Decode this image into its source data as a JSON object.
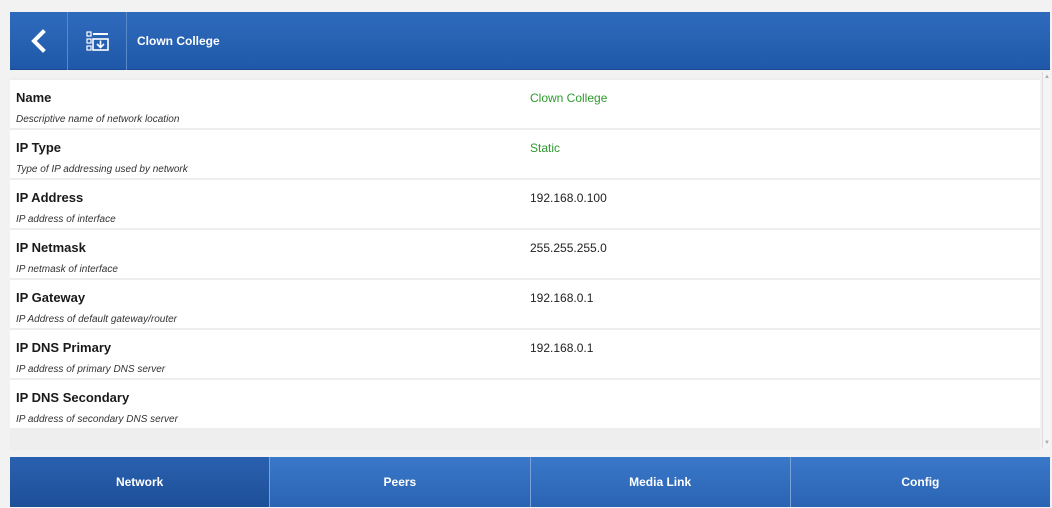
{
  "header": {
    "title": "Clown College",
    "back_icon": "chevron-left-icon",
    "list_icon": "list-download-icon",
    "color": "#2563b0"
  },
  "rows": [
    {
      "label": "Name",
      "description": "Descriptive name of network location",
      "value": "Clown College",
      "value_color": "green"
    },
    {
      "label": "IP Type",
      "description": "Type of IP addressing used by network",
      "value": "Static",
      "value_color": "green"
    },
    {
      "label": "IP Address",
      "description": "IP address of interface",
      "value": "192.168.0.100",
      "value_color": "default"
    },
    {
      "label": "IP Netmask",
      "description": "IP netmask of interface",
      "value": "255.255.255.0",
      "value_color": "default"
    },
    {
      "label": "IP Gateway",
      "description": "IP Address of default gateway/router",
      "value": "192.168.0.1",
      "value_color": "default"
    },
    {
      "label": "IP DNS Primary",
      "description": "IP address of primary DNS server",
      "value": "192.168.0.1",
      "value_color": "default"
    },
    {
      "label": "IP DNS Secondary",
      "description": "IP address of secondary DNS server",
      "value": "",
      "value_color": "default"
    }
  ],
  "tabs": [
    {
      "label": "Network",
      "active": true
    },
    {
      "label": "Peers",
      "active": false
    },
    {
      "label": "Media Link",
      "active": false
    },
    {
      "label": "Config",
      "active": false
    }
  ],
  "colors": {
    "accent": "#2563b0",
    "value_green": "#2d9a2d"
  }
}
